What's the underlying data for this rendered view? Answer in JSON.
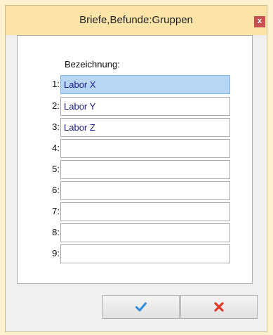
{
  "window": {
    "title": "Briefe,Befunde:Gruppen",
    "close_glyph": "x"
  },
  "table": {
    "column_header": "Bezeichnung:",
    "rows": [
      {
        "num": "1:",
        "value": "Labor X",
        "selected": true
      },
      {
        "num": "2:",
        "value": "Labor Y",
        "selected": false
      },
      {
        "num": "3:",
        "value": "Labor Z",
        "selected": false
      },
      {
        "num": "4:",
        "value": "",
        "selected": false
      },
      {
        "num": "5:",
        "value": "",
        "selected": false
      },
      {
        "num": "6:",
        "value": "",
        "selected": false
      },
      {
        "num": "7:",
        "value": "",
        "selected": false
      },
      {
        "num": "8:",
        "value": "",
        "selected": false
      },
      {
        "num": "9:",
        "value": "",
        "selected": false
      }
    ]
  },
  "buttons": {
    "ok_icon": "check-icon",
    "cancel_icon": "x-icon"
  },
  "colors": {
    "titlebar": "#FCE4A8",
    "close_button": "#C75050",
    "selection": "#B7D5F4",
    "text_value": "#1C1C8C",
    "ok_icon": "#2E8CDB",
    "cancel_icon": "#E03B2A"
  }
}
